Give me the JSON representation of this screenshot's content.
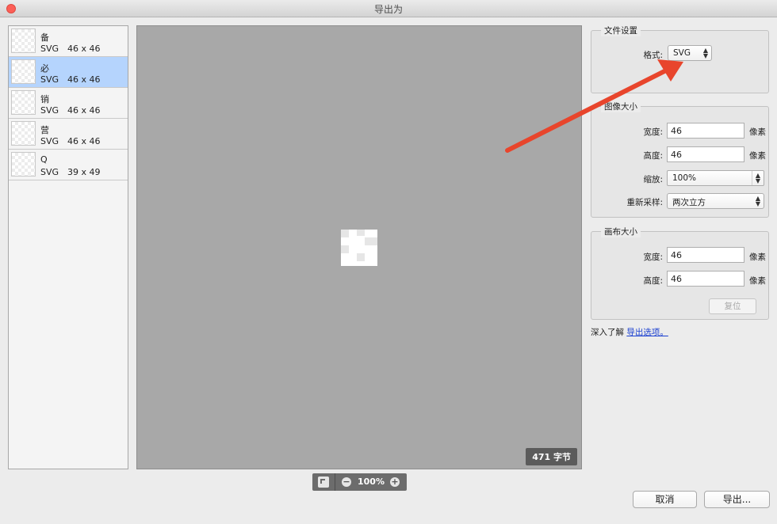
{
  "window": {
    "title": "导出为"
  },
  "assets": [
    {
      "name": "备",
      "format": "SVG",
      "size": "46 x 46",
      "selected": false
    },
    {
      "name": "必",
      "format": "SVG",
      "size": "46 x 46",
      "selected": true
    },
    {
      "name": "销",
      "format": "SVG",
      "size": "46 x 46",
      "selected": false
    },
    {
      "name": "营",
      "format": "SVG",
      "size": "46 x 46",
      "selected": false
    },
    {
      "name": "Q",
      "format": "SVG",
      "size": "39 x 49",
      "selected": false
    }
  ],
  "preview": {
    "bytes_label": "471 字节"
  },
  "zoom": {
    "value": "100%"
  },
  "file_settings": {
    "group_label": "文件设置",
    "format_label": "格式:",
    "format_value": "SVG"
  },
  "image_size": {
    "group_label": "图像大小",
    "width_label": "宽度:",
    "width_value": "46",
    "height_label": "高度:",
    "height_value": "46",
    "unit": "像素",
    "scale_label": "缩放:",
    "scale_value": "100%",
    "resample_label": "重新采样:",
    "resample_value": "两次立方"
  },
  "canvas_size": {
    "group_label": "画布大小",
    "width_label": "宽度:",
    "width_value": "46",
    "height_label": "高度:",
    "height_value": "46",
    "unit": "像素",
    "reset_label": "复位"
  },
  "learn": {
    "prefix": "深入了解",
    "link": "导出选项。"
  },
  "buttons": {
    "cancel": "取消",
    "export": "导出..."
  },
  "colors": {
    "annotation_arrow": "#e8452c",
    "selection": "#b5d4fd"
  }
}
